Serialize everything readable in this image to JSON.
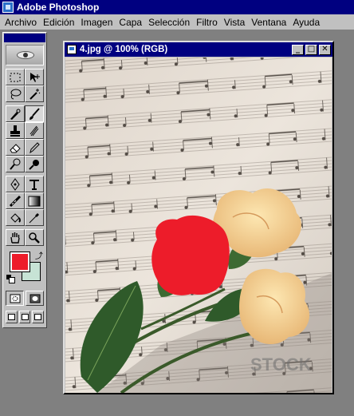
{
  "app": {
    "title": "Adobe Photoshop"
  },
  "menu": [
    "Archivo",
    "Edición",
    "Imagen",
    "Capa",
    "Selección",
    "Filtro",
    "Vista",
    "Ventana",
    "Ayuda"
  ],
  "tools": [
    {
      "name": "marquee-tool",
      "icon": "dashed-rect-icon"
    },
    {
      "name": "move-tool",
      "icon": "move-arrows-icon"
    },
    {
      "name": "lasso-tool",
      "icon": "lasso-icon"
    },
    {
      "name": "magic-wand-tool",
      "icon": "magic-wand-icon"
    },
    {
      "name": "airbrush-tool",
      "icon": "airbrush-icon"
    },
    {
      "name": "paintbrush-tool",
      "icon": "paintbrush-icon",
      "active": true
    },
    {
      "name": "rubber-stamp-tool",
      "icon": "stamp-icon"
    },
    {
      "name": "smudge-tool",
      "icon": "smudge-icon"
    },
    {
      "name": "eraser-tool",
      "icon": "eraser-icon"
    },
    {
      "name": "pencil-tool",
      "icon": "pencil-icon"
    },
    {
      "name": "dodge-tool",
      "icon": "dodge-icon"
    },
    {
      "name": "burn-tool",
      "icon": "burn-icon"
    },
    {
      "name": "pen-tool",
      "icon": "pen-icon"
    },
    {
      "name": "type-tool",
      "icon": "type-icon"
    },
    {
      "name": "line-tool",
      "icon": "line-icon"
    },
    {
      "name": "gradient-tool",
      "icon": "gradient-icon"
    },
    {
      "name": "paint-bucket-tool",
      "icon": "bucket-icon"
    },
    {
      "name": "eyedropper-tool",
      "icon": "eyedropper-icon"
    },
    {
      "name": "hand-tool",
      "icon": "hand-icon"
    },
    {
      "name": "zoom-tool",
      "icon": "magnifier-icon"
    }
  ],
  "colors": {
    "foreground": "#ed1c2a",
    "background": "#c7e3d5"
  },
  "document": {
    "title": "4.jpg @ 100% (RGB)",
    "watermark": "STOCK"
  }
}
